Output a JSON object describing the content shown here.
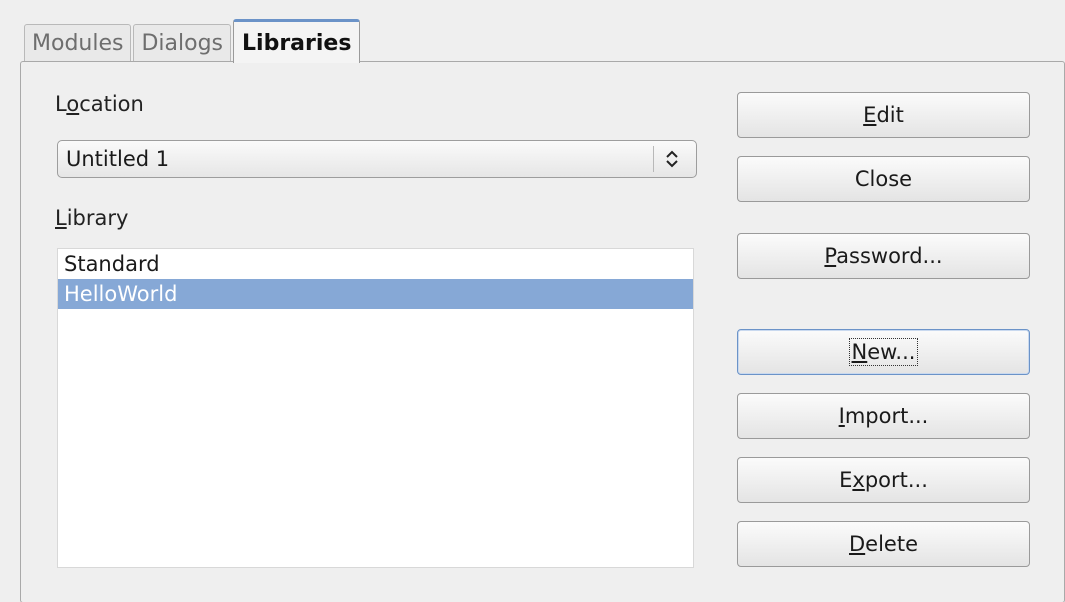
{
  "tabs": [
    {
      "label": "Modules",
      "active": false
    },
    {
      "label": "Dialogs",
      "active": false
    },
    {
      "label": "Libraries",
      "active": true
    }
  ],
  "location": {
    "label_pre": "L",
    "label_mnemonic": "o",
    "label_post": "cation",
    "value": "Untitled 1"
  },
  "library": {
    "label_mnemonic": "L",
    "label_post": "ibrary",
    "items": [
      {
        "label": "Standard",
        "selected": false
      },
      {
        "label": "HelloWorld",
        "selected": true
      }
    ]
  },
  "buttons": {
    "edit": {
      "pre": "",
      "mnemonic": "E",
      "post": "dit"
    },
    "close": {
      "pre": "",
      "mnemonic": "",
      "post": "Close"
    },
    "password": {
      "pre": "",
      "mnemonic": "P",
      "post": "assword..."
    },
    "new": {
      "pre": "",
      "mnemonic": "N",
      "post": "ew..."
    },
    "import": {
      "pre": "",
      "mnemonic": "I",
      "post": "mport..."
    },
    "export": {
      "pre": "E",
      "mnemonic": "x",
      "post": "port..."
    },
    "delete": {
      "pre": "",
      "mnemonic": "D",
      "post": "elete"
    }
  },
  "colors": {
    "selection": "#86a8d6",
    "focus": "#6b93c8"
  },
  "icons": {
    "location_dropdown": "updown-chevron-icon"
  }
}
